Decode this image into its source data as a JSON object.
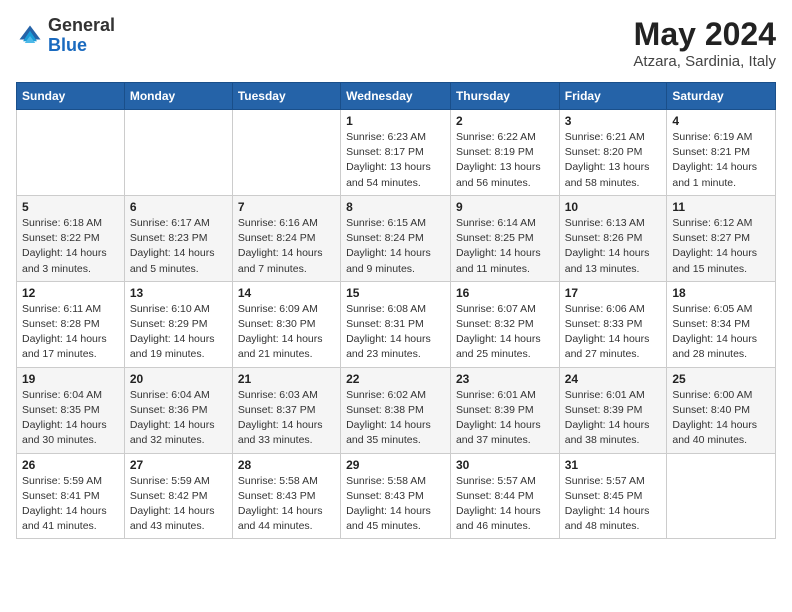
{
  "header": {
    "logo_general": "General",
    "logo_blue": "Blue",
    "month_title": "May 2024",
    "location": "Atzara, Sardinia, Italy"
  },
  "days_of_week": [
    "Sunday",
    "Monday",
    "Tuesday",
    "Wednesday",
    "Thursday",
    "Friday",
    "Saturday"
  ],
  "weeks": [
    [
      {
        "num": "",
        "sunrise": "",
        "sunset": "",
        "daylight": ""
      },
      {
        "num": "",
        "sunrise": "",
        "sunset": "",
        "daylight": ""
      },
      {
        "num": "",
        "sunrise": "",
        "sunset": "",
        "daylight": ""
      },
      {
        "num": "1",
        "sunrise": "Sunrise: 6:23 AM",
        "sunset": "Sunset: 8:17 PM",
        "daylight": "Daylight: 13 hours and 54 minutes."
      },
      {
        "num": "2",
        "sunrise": "Sunrise: 6:22 AM",
        "sunset": "Sunset: 8:19 PM",
        "daylight": "Daylight: 13 hours and 56 minutes."
      },
      {
        "num": "3",
        "sunrise": "Sunrise: 6:21 AM",
        "sunset": "Sunset: 8:20 PM",
        "daylight": "Daylight: 13 hours and 58 minutes."
      },
      {
        "num": "4",
        "sunrise": "Sunrise: 6:19 AM",
        "sunset": "Sunset: 8:21 PM",
        "daylight": "Daylight: 14 hours and 1 minute."
      }
    ],
    [
      {
        "num": "5",
        "sunrise": "Sunrise: 6:18 AM",
        "sunset": "Sunset: 8:22 PM",
        "daylight": "Daylight: 14 hours and 3 minutes."
      },
      {
        "num": "6",
        "sunrise": "Sunrise: 6:17 AM",
        "sunset": "Sunset: 8:23 PM",
        "daylight": "Daylight: 14 hours and 5 minutes."
      },
      {
        "num": "7",
        "sunrise": "Sunrise: 6:16 AM",
        "sunset": "Sunset: 8:24 PM",
        "daylight": "Daylight: 14 hours and 7 minutes."
      },
      {
        "num": "8",
        "sunrise": "Sunrise: 6:15 AM",
        "sunset": "Sunset: 8:24 PM",
        "daylight": "Daylight: 14 hours and 9 minutes."
      },
      {
        "num": "9",
        "sunrise": "Sunrise: 6:14 AM",
        "sunset": "Sunset: 8:25 PM",
        "daylight": "Daylight: 14 hours and 11 minutes."
      },
      {
        "num": "10",
        "sunrise": "Sunrise: 6:13 AM",
        "sunset": "Sunset: 8:26 PM",
        "daylight": "Daylight: 14 hours and 13 minutes."
      },
      {
        "num": "11",
        "sunrise": "Sunrise: 6:12 AM",
        "sunset": "Sunset: 8:27 PM",
        "daylight": "Daylight: 14 hours and 15 minutes."
      }
    ],
    [
      {
        "num": "12",
        "sunrise": "Sunrise: 6:11 AM",
        "sunset": "Sunset: 8:28 PM",
        "daylight": "Daylight: 14 hours and 17 minutes."
      },
      {
        "num": "13",
        "sunrise": "Sunrise: 6:10 AM",
        "sunset": "Sunset: 8:29 PM",
        "daylight": "Daylight: 14 hours and 19 minutes."
      },
      {
        "num": "14",
        "sunrise": "Sunrise: 6:09 AM",
        "sunset": "Sunset: 8:30 PM",
        "daylight": "Daylight: 14 hours and 21 minutes."
      },
      {
        "num": "15",
        "sunrise": "Sunrise: 6:08 AM",
        "sunset": "Sunset: 8:31 PM",
        "daylight": "Daylight: 14 hours and 23 minutes."
      },
      {
        "num": "16",
        "sunrise": "Sunrise: 6:07 AM",
        "sunset": "Sunset: 8:32 PM",
        "daylight": "Daylight: 14 hours and 25 minutes."
      },
      {
        "num": "17",
        "sunrise": "Sunrise: 6:06 AM",
        "sunset": "Sunset: 8:33 PM",
        "daylight": "Daylight: 14 hours and 27 minutes."
      },
      {
        "num": "18",
        "sunrise": "Sunrise: 6:05 AM",
        "sunset": "Sunset: 8:34 PM",
        "daylight": "Daylight: 14 hours and 28 minutes."
      }
    ],
    [
      {
        "num": "19",
        "sunrise": "Sunrise: 6:04 AM",
        "sunset": "Sunset: 8:35 PM",
        "daylight": "Daylight: 14 hours and 30 minutes."
      },
      {
        "num": "20",
        "sunrise": "Sunrise: 6:04 AM",
        "sunset": "Sunset: 8:36 PM",
        "daylight": "Daylight: 14 hours and 32 minutes."
      },
      {
        "num": "21",
        "sunrise": "Sunrise: 6:03 AM",
        "sunset": "Sunset: 8:37 PM",
        "daylight": "Daylight: 14 hours and 33 minutes."
      },
      {
        "num": "22",
        "sunrise": "Sunrise: 6:02 AM",
        "sunset": "Sunset: 8:38 PM",
        "daylight": "Daylight: 14 hours and 35 minutes."
      },
      {
        "num": "23",
        "sunrise": "Sunrise: 6:01 AM",
        "sunset": "Sunset: 8:39 PM",
        "daylight": "Daylight: 14 hours and 37 minutes."
      },
      {
        "num": "24",
        "sunrise": "Sunrise: 6:01 AM",
        "sunset": "Sunset: 8:39 PM",
        "daylight": "Daylight: 14 hours and 38 minutes."
      },
      {
        "num": "25",
        "sunrise": "Sunrise: 6:00 AM",
        "sunset": "Sunset: 8:40 PM",
        "daylight": "Daylight: 14 hours and 40 minutes."
      }
    ],
    [
      {
        "num": "26",
        "sunrise": "Sunrise: 5:59 AM",
        "sunset": "Sunset: 8:41 PM",
        "daylight": "Daylight: 14 hours and 41 minutes."
      },
      {
        "num": "27",
        "sunrise": "Sunrise: 5:59 AM",
        "sunset": "Sunset: 8:42 PM",
        "daylight": "Daylight: 14 hours and 43 minutes."
      },
      {
        "num": "28",
        "sunrise": "Sunrise: 5:58 AM",
        "sunset": "Sunset: 8:43 PM",
        "daylight": "Daylight: 14 hours and 44 minutes."
      },
      {
        "num": "29",
        "sunrise": "Sunrise: 5:58 AM",
        "sunset": "Sunset: 8:43 PM",
        "daylight": "Daylight: 14 hours and 45 minutes."
      },
      {
        "num": "30",
        "sunrise": "Sunrise: 5:57 AM",
        "sunset": "Sunset: 8:44 PM",
        "daylight": "Daylight: 14 hours and 46 minutes."
      },
      {
        "num": "31",
        "sunrise": "Sunrise: 5:57 AM",
        "sunset": "Sunset: 8:45 PM",
        "daylight": "Daylight: 14 hours and 48 minutes."
      },
      {
        "num": "",
        "sunrise": "",
        "sunset": "",
        "daylight": ""
      }
    ]
  ]
}
